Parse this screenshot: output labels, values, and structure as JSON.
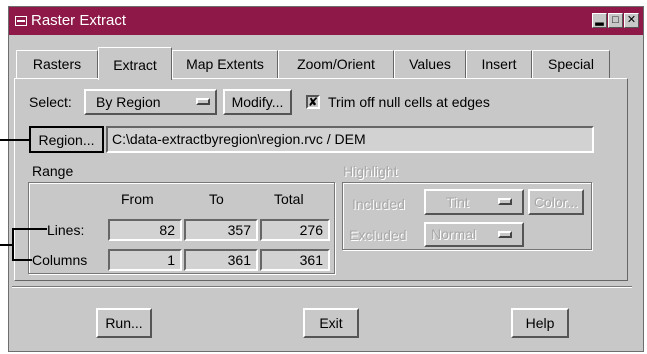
{
  "window": {
    "title": "Raster Extract"
  },
  "tabs": [
    {
      "label": "Rasters"
    },
    {
      "label": "Extract"
    },
    {
      "label": "Map Extents"
    },
    {
      "label": "Zoom/Orient"
    },
    {
      "label": "Values"
    },
    {
      "label": "Insert"
    },
    {
      "label": "Special"
    }
  ],
  "select_row": {
    "select_label": "Select:",
    "select_value": "By Region",
    "modify_label": "Modify...",
    "trim_label": "Trim off null cells at edges",
    "trim_checked": "✘"
  },
  "region": {
    "button_label": "Region...",
    "path": "C:\\data-extractbyregion\\region.rvc / DEM"
  },
  "range": {
    "title": "Range",
    "headers": [
      "From",
      "To",
      "Total"
    ],
    "rows": [
      {
        "label": "Lines:",
        "from": "82",
        "to": "357",
        "total": "276"
      },
      {
        "label": "Columns",
        "from": "1",
        "to": "361",
        "total": "361"
      }
    ]
  },
  "highlight": {
    "title": "Highlight",
    "included_label": "Included",
    "included_value": "Tint",
    "color_label": "Color...",
    "excluded_label": "Excluded",
    "excluded_value": "Normal"
  },
  "buttons": {
    "run": "Run...",
    "exit": "Exit",
    "help": "Help"
  }
}
